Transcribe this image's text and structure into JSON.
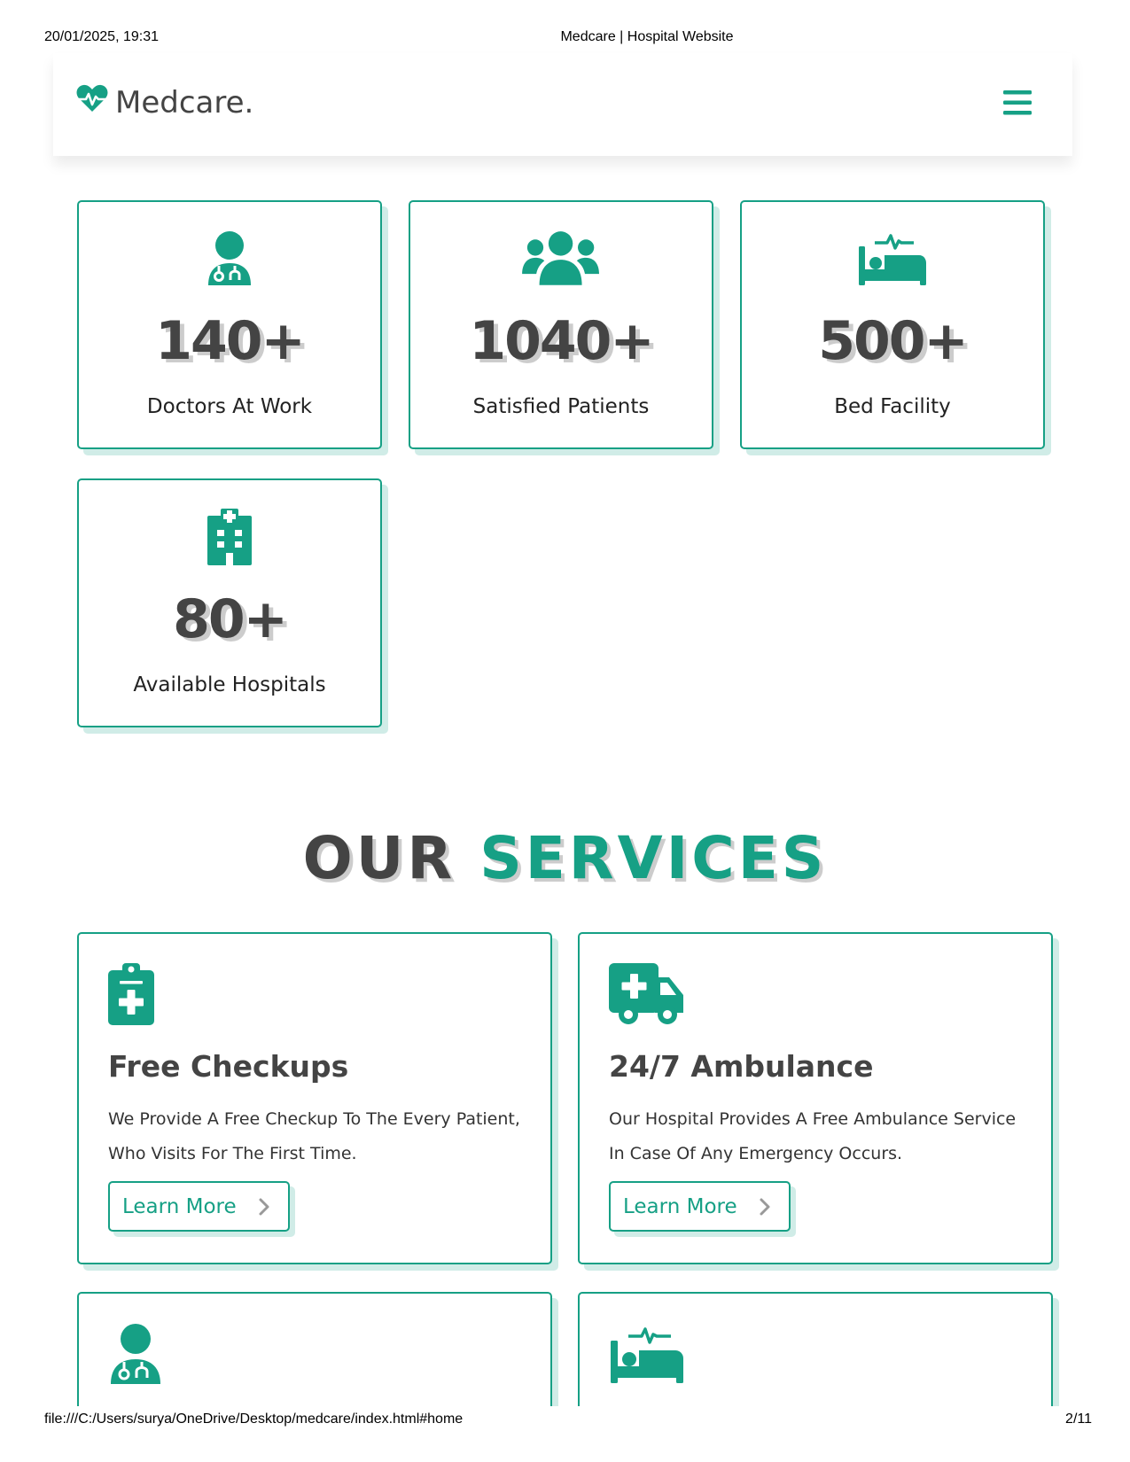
{
  "print": {
    "date": "20/01/2025, 19:31",
    "title": "Medcare | Hospital Website",
    "url": "file:///C:/Users/surya/OneDrive/Desktop/medcare/index.html#home",
    "page": "2/11"
  },
  "navbar": {
    "logo_text": "Medcare.",
    "logo_icon": "heartbeat-icon",
    "menu_icon": "hamburger-icon"
  },
  "stats": [
    {
      "icon": "user-doctor-icon",
      "number": "140+",
      "label": "Doctors At Work"
    },
    {
      "icon": "users-icon",
      "number": "1040+",
      "label": "Satisfied Patients"
    },
    {
      "icon": "bed-pulse-icon",
      "number": "500+",
      "label": "Bed Facility"
    },
    {
      "icon": "hospital-icon",
      "number": "80+",
      "label": "Available Hospitals"
    }
  ],
  "services_heading": {
    "first": "OUR",
    "accent": "SERVICES"
  },
  "services": [
    {
      "icon": "clipboard-medical-icon",
      "title": "Free Checkups",
      "text": "We Provide A Free Checkup To The Every Patient, Who Visits For The First Time.",
      "button": "Learn More"
    },
    {
      "icon": "ambulance-icon",
      "title": "24/7 Ambulance",
      "text": "Our Hospital Provides A Free Ambulance Service In Case Of Any Emergency Occurs.",
      "button": "Learn More"
    },
    {
      "icon": "user-doctor-icon"
    },
    {
      "icon": "bed-pulse-icon"
    }
  ],
  "colors": {
    "accent": "#16a085",
    "dark_text": "#444444"
  }
}
